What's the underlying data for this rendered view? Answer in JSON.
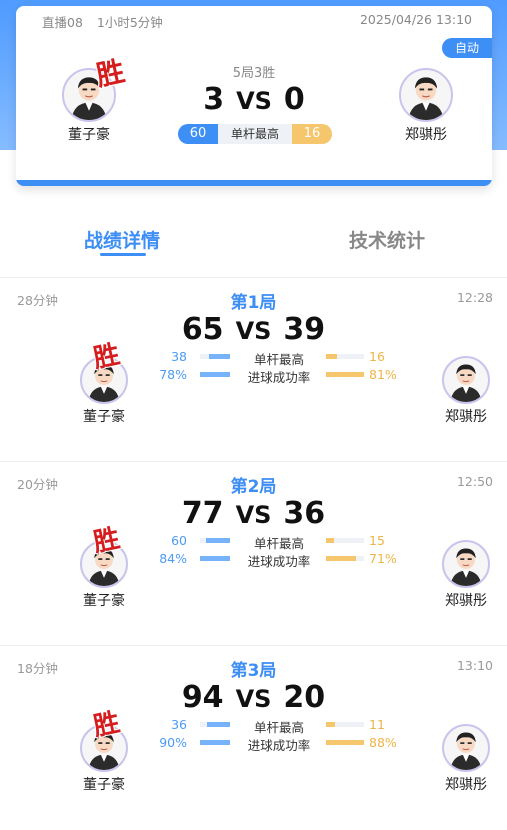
{
  "header": {
    "room": "直播08",
    "duration": "1小时5分钟",
    "datetime": "2025/04/26 13:10",
    "badge": "自动",
    "format": "5局3胜",
    "score_left": "3",
    "vs": "VS",
    "score_right": "0",
    "highest_break_label": "单杆最高",
    "highest_break_left": "60",
    "highest_break_right": "16",
    "win_mark": "胜"
  },
  "players": {
    "left": {
      "name": "董子豪",
      "avatar_icon": "player-avatar-icon"
    },
    "right": {
      "name": "郑骐彤",
      "avatar_icon": "player-avatar-icon"
    }
  },
  "tabs": [
    {
      "label": "战绩详情",
      "active": true
    },
    {
      "label": "技术统计",
      "active": false
    }
  ],
  "sets": [
    {
      "duration": "28分钟",
      "title": "第1局",
      "time": "12:28",
      "score_left": "65",
      "vs": "VS",
      "score_right": "39",
      "win_mark": "胜",
      "stats": [
        {
          "label": "单杆最高",
          "left": "38",
          "right": "16",
          "left_fraction": 0.7,
          "right_fraction": 0.3
        },
        {
          "label": "进球成功率",
          "left": "78%",
          "right": "81%",
          "left_fraction": 1.0,
          "right_fraction": 1.0
        }
      ]
    },
    {
      "duration": "20分钟",
      "title": "第2局",
      "time": "12:50",
      "score_left": "77",
      "vs": "VS",
      "score_right": "36",
      "win_mark": "胜",
      "stats": [
        {
          "label": "单杆最高",
          "left": "60",
          "right": "15",
          "left_fraction": 0.8,
          "right_fraction": 0.2
        },
        {
          "label": "进球成功率",
          "left": "84%",
          "right": "71%",
          "left_fraction": 1.0,
          "right_fraction": 0.8
        }
      ]
    },
    {
      "duration": "18分钟",
      "title": "第3局",
      "time": "13:10",
      "score_left": "94",
      "vs": "VS",
      "score_right": "20",
      "win_mark": "胜",
      "stats": [
        {
          "label": "单杆最高",
          "left": "36",
          "right": "11",
          "left_fraction": 0.77,
          "right_fraction": 0.23
        },
        {
          "label": "进球成功率",
          "left": "90%",
          "right": "88%",
          "left_fraction": 1.0,
          "right_fraction": 1.0
        }
      ]
    }
  ],
  "colors": {
    "accent": "#3d8ef5",
    "left_bar": "#76b3fb",
    "right_bar": "#f6c66c",
    "win": "#d51d1d"
  }
}
